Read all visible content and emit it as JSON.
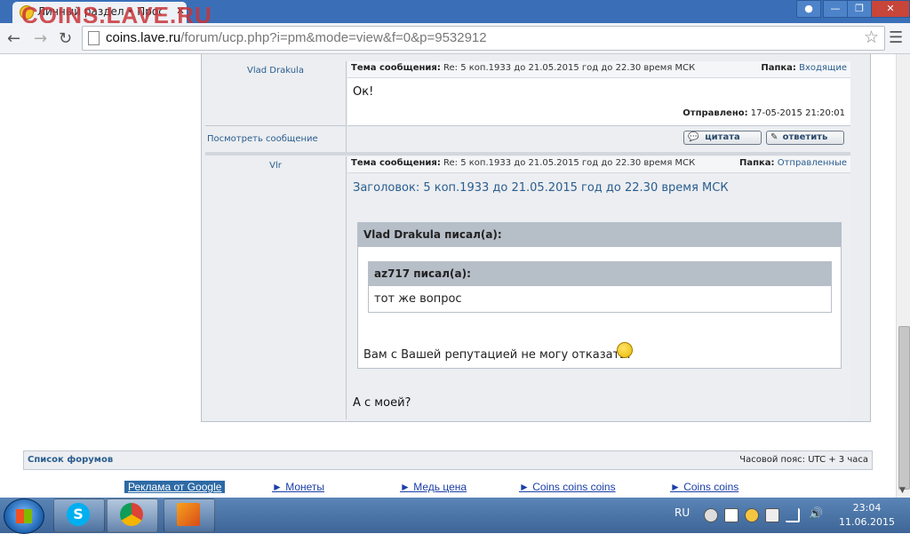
{
  "browser": {
    "tab_title": "Личный раздел • Просм",
    "tab_close": "✕",
    "logo_text": "COINS.LAVE.RU",
    "url_host": "coins.lave.ru",
    "url_path": "/forum/ucp.php?i=pm&mode=view&f=0&p=9532912"
  },
  "posts": [
    {
      "author": "Vlad Drakula",
      "subject_label": "Тема сообщения:",
      "subject": "Re: 5 коп.1933 до 21.05.2015 год до 22.30 время МСК",
      "folder_label": "Папка:",
      "folder": "Входящие",
      "body": "Ок!",
      "sent_label": "Отправлено:",
      "sent": "17-05-2015 21:20:01",
      "view_link": "Посмотреть сообщение",
      "quote_btn": "цитата",
      "reply_btn": "ответить"
    },
    {
      "author": "Vlr",
      "subject_label": "Тема сообщения:",
      "subject": "Re: 5 коп.1933 до 21.05.2015 год до 22.30 время МСК",
      "folder_label": "Папка:",
      "folder": "Отправленные",
      "heading": "Заголовок: 5 коп.1933 до 21.05.2015 год до 22.30 время МСК",
      "quote_outer_head": "Vlad Drakula писал(а):",
      "quote_inner_head": "az717 писал(а):",
      "quote_inner_body": "тот же вопрос",
      "quote_outer_body": "Вам с Вашей репутацией не могу отказать!",
      "reply_text": "А с моей?"
    }
  ],
  "footer": {
    "forum_list": "Список форумов",
    "timezone": "Часовой пояс: UTC + 3 часа"
  },
  "ads": {
    "brand": "Реклама от Google",
    "links": [
      "► Монеты",
      "► Медь цена",
      "► Coins coins coins",
      "► Coins coins"
    ]
  },
  "taskbar": {
    "lang": "RU",
    "time": "23:04",
    "date": "11.06.2015"
  }
}
